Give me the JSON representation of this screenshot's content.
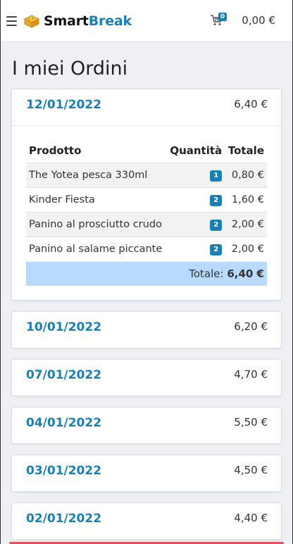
{
  "header": {
    "brand_part1": "Smart",
    "brand_part2": "Break",
    "cart_count": "0",
    "cart_total": "0,00 €"
  },
  "page_title": "I miei Ordini",
  "orders": [
    {
      "date": "12/01/2022",
      "total": "6,40 €",
      "expanded": true,
      "columns": {
        "product": "Prodotto",
        "qty": "Quantità",
        "total": "Totale"
      },
      "items": [
        {
          "name": "The Yotea pesca 330ml",
          "qty": "1",
          "total": "0,80 €"
        },
        {
          "name": "Kinder Fiesta",
          "qty": "2",
          "total": "1,60 €"
        },
        {
          "name": "Panino al prosciutto crudo",
          "qty": "2",
          "total": "2,00 €"
        },
        {
          "name": "Panino al salame piccante",
          "qty": "2",
          "total": "2,00 €"
        }
      ],
      "footer_label": "Totale:",
      "footer_total": "6,40 €"
    },
    {
      "date": "10/01/2022",
      "total": "6,20 €"
    },
    {
      "date": "07/01/2022",
      "total": "4,70 €"
    },
    {
      "date": "04/01/2022",
      "total": "5,50 €"
    },
    {
      "date": "03/01/2022",
      "total": "4,50 €"
    },
    {
      "date": "02/01/2022",
      "total": "4,40 €"
    }
  ],
  "colors": {
    "accent": "#1a7fb3",
    "total_row": "#b8daff",
    "bottom_bar": "#e05260"
  }
}
